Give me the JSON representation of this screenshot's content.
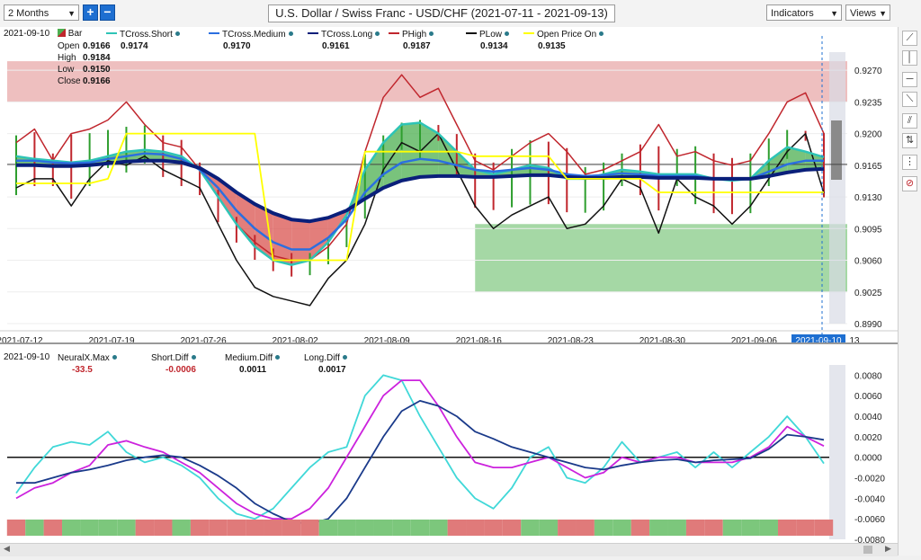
{
  "toolbar": {
    "period": "2 Months",
    "zoom_in": "+",
    "zoom_out": "−",
    "title": "U.S. Dollar / Swiss Franc - USD/CHF (2021-07-11 - 2021-09-13)",
    "indicators": "Indicators",
    "views": "Views"
  },
  "upper_legend": {
    "date": "2021-09-10",
    "bar_label": "Bar",
    "open_label": "Open",
    "open": "0.9166",
    "high_label": "High",
    "high": "0.9184",
    "low_label": "Low",
    "low": "0.9150",
    "close_label": "Close",
    "close": "0.9166",
    "items": [
      {
        "name": "TCross.Short",
        "value": "0.9174",
        "color": "#2ec4b6"
      },
      {
        "name": "TCross.Medium",
        "value": "0.9170",
        "color": "#2b6fe0"
      },
      {
        "name": "TCross.Long",
        "value": "0.9161",
        "color": "#0a1f7a"
      },
      {
        "name": "PHigh",
        "value": "0.9187",
        "color": "#c0262d"
      },
      {
        "name": "PLow",
        "value": "0.9134",
        "color": "#111111"
      },
      {
        "name": "Open Price On",
        "value": "0.9135",
        "color": "#ffff00"
      }
    ]
  },
  "lower_legend": {
    "date": "2021-09-10",
    "items": [
      {
        "name": "NeuralX.Max",
        "value": "-33.5",
        "color": "#c0262d"
      },
      {
        "name": "Short.Diff",
        "value": "-0.0006",
        "color": "#c0262d"
      },
      {
        "name": "Medium.Diff",
        "value": "0.0011",
        "color": "#111111"
      },
      {
        "name": "Long.Diff",
        "value": "0.0017",
        "color": "#111111"
      }
    ]
  },
  "colors": {
    "tcross_short": "#2ec4b6",
    "tcross_medium": "#2b6fe0",
    "tcross_long": "#0a1f7a",
    "phigh": "#c0262d",
    "plow": "#111111",
    "open_price": "#ffff00",
    "short_diff": "#40d8d8",
    "medium_diff": "#cc22dd",
    "long_diff": "#1a3a8a",
    "bull": "#4caf50",
    "bear": "#d9534f"
  },
  "chart_data": [
    {
      "type": "line",
      "ylim": [
        0.899,
        0.929
      ],
      "y_ticks": [
        "0.9270",
        "0.9235",
        "0.9200",
        "0.9165",
        "0.9130",
        "0.9095",
        "0.9060",
        "0.9025",
        "0.8990"
      ],
      "x_ticks": [
        "2021-07-12",
        "2021-07-19",
        "2021-07-26",
        "2021-08-02",
        "2021-08-09",
        "2021-08-16",
        "2021-08-23",
        "2021-08-30",
        "2021-09-06"
      ],
      "highlight_date": "2021-09-10",
      "trailing_tick": "13",
      "x": [
        "07-12",
        "07-13",
        "07-14",
        "07-15",
        "07-16",
        "07-19",
        "07-20",
        "07-21",
        "07-22",
        "07-23",
        "07-26",
        "07-27",
        "07-28",
        "07-29",
        "07-30",
        "08-02",
        "08-03",
        "08-04",
        "08-05",
        "08-06",
        "08-09",
        "08-10",
        "08-11",
        "08-12",
        "08-13",
        "08-16",
        "08-17",
        "08-18",
        "08-19",
        "08-20",
        "08-23",
        "08-24",
        "08-25",
        "08-26",
        "08-27",
        "08-30",
        "08-31",
        "09-01",
        "09-02",
        "09-03",
        "09-06",
        "09-07",
        "09-08",
        "09-09",
        "09-10"
      ],
      "series": [
        {
          "name": "PHigh",
          "values": [
            0.919,
            0.9205,
            0.917,
            0.92,
            0.9205,
            0.9215,
            0.9235,
            0.921,
            0.919,
            0.9185,
            0.916,
            0.913,
            0.91,
            0.908,
            0.9065,
            0.906,
            0.906,
            0.9075,
            0.91,
            0.918,
            0.924,
            0.9265,
            0.924,
            0.925,
            0.921,
            0.917,
            0.916,
            0.9175,
            0.919,
            0.92,
            0.918,
            0.9155,
            0.916,
            0.917,
            0.918,
            0.921,
            0.9175,
            0.918,
            0.917,
            0.9165,
            0.917,
            0.92,
            0.9235,
            0.9245,
            0.92
          ]
        },
        {
          "name": "PLow",
          "values": [
            0.914,
            0.915,
            0.915,
            0.912,
            0.915,
            0.917,
            0.9165,
            0.9175,
            0.916,
            0.915,
            0.914,
            0.91,
            0.906,
            0.903,
            0.902,
            0.9015,
            0.901,
            0.904,
            0.906,
            0.91,
            0.916,
            0.919,
            0.918,
            0.92,
            0.916,
            0.912,
            0.9095,
            0.911,
            0.912,
            0.913,
            0.9095,
            0.91,
            0.912,
            0.915,
            0.914,
            0.909,
            0.915,
            0.913,
            0.912,
            0.91,
            0.912,
            0.915,
            0.918,
            0.92,
            0.9134
          ]
        },
        {
          "name": "TCross.Short",
          "values": [
            0.9175,
            0.9172,
            0.917,
            0.9168,
            0.917,
            0.9175,
            0.918,
            0.9182,
            0.918,
            0.9175,
            0.916,
            0.913,
            0.91,
            0.9075,
            0.906,
            0.9055,
            0.906,
            0.908,
            0.911,
            0.916,
            0.919,
            0.921,
            0.9212,
            0.92,
            0.918,
            0.916,
            0.9155,
            0.916,
            0.9165,
            0.9162,
            0.915,
            0.915,
            0.9155,
            0.916,
            0.9158,
            0.9155,
            0.9155,
            0.9155,
            0.915,
            0.9148,
            0.915,
            0.917,
            0.9185,
            0.918,
            0.9174
          ]
        },
        {
          "name": "TCross.Medium",
          "values": [
            0.917,
            0.917,
            0.9168,
            0.9167,
            0.9168,
            0.9172,
            0.9175,
            0.9178,
            0.9177,
            0.9172,
            0.916,
            0.914,
            0.9115,
            0.9095,
            0.908,
            0.9072,
            0.9072,
            0.9085,
            0.9105,
            0.9135,
            0.9155,
            0.9168,
            0.9172,
            0.917,
            0.9165,
            0.916,
            0.9158,
            0.916,
            0.9162,
            0.916,
            0.9155,
            0.9153,
            0.9154,
            0.9156,
            0.9155,
            0.9153,
            0.9153,
            0.9153,
            0.915,
            0.9149,
            0.915,
            0.9158,
            0.9166,
            0.917,
            0.917
          ]
        },
        {
          "name": "TCross.Long",
          "values": [
            0.9165,
            0.9165,
            0.9164,
            0.9164,
            0.9165,
            0.9167,
            0.9169,
            0.917,
            0.917,
            0.9168,
            0.9162,
            0.915,
            0.9135,
            0.9122,
            0.9112,
            0.9105,
            0.9103,
            0.9107,
            0.9115,
            0.9128,
            0.914,
            0.9148,
            0.9152,
            0.9153,
            0.9153,
            0.9152,
            0.9152,
            0.9153,
            0.9154,
            0.9154,
            0.9152,
            0.9151,
            0.9151,
            0.9152,
            0.9152,
            0.9151,
            0.9151,
            0.9151,
            0.915,
            0.915,
            0.915,
            0.9153,
            0.9157,
            0.916,
            0.9161
          ]
        },
        {
          "name": "Open Price On",
          "values": [
            0.9145,
            0.9145,
            0.9145,
            0.9145,
            0.9145,
            0.915,
            0.92,
            0.92,
            0.92,
            0.92,
            0.92,
            0.92,
            0.92,
            0.92,
            0.906,
            0.906,
            0.906,
            0.906,
            0.906,
            0.918,
            0.918,
            0.918,
            0.918,
            0.918,
            0.918,
            0.9175,
            0.9175,
            0.9175,
            0.9175,
            0.9175,
            0.915,
            0.915,
            0.915,
            0.915,
            0.915,
            0.9135,
            0.9135,
            0.9135,
            0.9135,
            0.9135,
            0.9135,
            0.9135,
            0.9135,
            0.9135,
            0.9135
          ]
        }
      ],
      "resistance_zone": [
        0.9235,
        0.928
      ],
      "support_zone": [
        0.9025,
        0.91
      ],
      "support_zone_start": "08-16",
      "current_price": 0.9166
    },
    {
      "type": "line",
      "ylim": [
        -0.008,
        0.009
      ],
      "y_ticks": [
        "0.0080",
        "0.0060",
        "0.0040",
        "0.0020",
        "0.0000",
        "-0.0020",
        "-0.0040",
        "-0.0060",
        "-0.0080"
      ],
      "series": [
        {
          "name": "Short.Diff",
          "values": [
            -0.0035,
            -0.001,
            0.001,
            0.0015,
            0.0012,
            0.0025,
            0.0005,
            -0.0005,
            0.0,
            -0.0008,
            -0.002,
            -0.004,
            -0.0055,
            -0.006,
            -0.005,
            -0.003,
            -0.001,
            0.0005,
            0.001,
            0.006,
            0.008,
            0.0075,
            0.004,
            0.001,
            -0.002,
            -0.004,
            -0.005,
            -0.003,
            0.0,
            0.001,
            -0.002,
            -0.0025,
            -0.001,
            0.0015,
            -0.0005,
            0.0,
            0.0005,
            -0.001,
            0.0005,
            -0.001,
            0.0005,
            0.002,
            0.004,
            0.002,
            -0.0006
          ]
        },
        {
          "name": "Medium.Diff",
          "values": [
            -0.004,
            -0.003,
            -0.0025,
            -0.0015,
            -0.0008,
            0.0012,
            0.0016,
            0.001,
            0.0005,
            -0.0005,
            -0.0015,
            -0.003,
            -0.0045,
            -0.0055,
            -0.006,
            -0.006,
            -0.005,
            -0.003,
            0.0,
            0.003,
            0.006,
            0.0075,
            0.0075,
            0.005,
            0.002,
            -0.0005,
            -0.001,
            -0.001,
            -0.0005,
            0.0,
            -0.001,
            -0.002,
            -0.0015,
            0.0,
            -0.0005,
            0.0,
            0.0,
            -0.0005,
            -0.0005,
            -0.0005,
            0.0,
            0.001,
            0.003,
            0.002,
            0.0011
          ]
        },
        {
          "name": "Long.Diff",
          "values": [
            -0.0025,
            -0.0025,
            -0.002,
            -0.0015,
            -0.0012,
            -0.0008,
            -0.0003,
            0.0,
            0.0002,
            0.0,
            -0.0008,
            -0.0018,
            -0.003,
            -0.0045,
            -0.0055,
            -0.0063,
            -0.0065,
            -0.006,
            -0.004,
            -0.001,
            0.002,
            0.0045,
            0.0055,
            0.005,
            0.004,
            0.0025,
            0.0018,
            0.001,
            0.0005,
            0.0,
            -0.0005,
            -0.001,
            -0.0012,
            -0.0008,
            -0.0005,
            -0.0003,
            -0.0002,
            -0.0005,
            -0.0003,
            -0.0002,
            -0.0001,
            0.0008,
            0.0022,
            0.002,
            0.0017
          ]
        }
      ],
      "neural_bar_signs": [
        -1,
        1,
        -1,
        1,
        1,
        1,
        1,
        -1,
        -1,
        1,
        -1,
        -1,
        -1,
        -1,
        -1,
        -1,
        -1,
        1,
        1,
        1,
        1,
        1,
        1,
        1,
        -1,
        -1,
        -1,
        -1,
        1,
        1,
        -1,
        -1,
        1,
        1,
        -1,
        1,
        1,
        -1,
        -1,
        1,
        1,
        1,
        -1,
        -1,
        -1
      ]
    }
  ]
}
